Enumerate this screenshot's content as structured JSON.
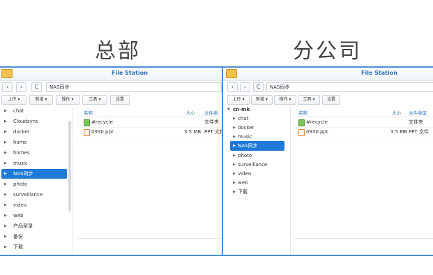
{
  "captions": {
    "hq": "总部",
    "branch": "分公司"
  },
  "hq": {
    "title": "File Station",
    "back_icon": "chevron-left-icon",
    "forward_icon": "chevron-right-icon",
    "refresh_icon": "refresh-icon",
    "back_glyph": "‹",
    "forward_glyph": "›",
    "refresh_glyph": "C",
    "path": "NAS同步",
    "toolbar": {
      "upload": "上传 ▾",
      "new": "新增 ▾",
      "action": "操作 ▾",
      "tools": "工具 ▾",
      "settings": "设置"
    },
    "sidebar": [
      {
        "label": "chat",
        "selected": false
      },
      {
        "label": "Cloudsync",
        "selected": false
      },
      {
        "label": "docker",
        "selected": false
      },
      {
        "label": "home",
        "selected": false
      },
      {
        "label": "homes",
        "selected": false
      },
      {
        "label": "music",
        "selected": false
      },
      {
        "label": "NAS同步",
        "selected": true
      },
      {
        "label": "photo",
        "selected": false
      },
      {
        "label": "surveillance",
        "selected": false
      },
      {
        "label": "video",
        "selected": false
      },
      {
        "label": "web",
        "selected": false
      },
      {
        "label": "产品型录",
        "selected": false
      },
      {
        "label": "备份",
        "selected": false
      },
      {
        "label": "下载",
        "selected": false
      }
    ],
    "columns": {
      "name": "名称",
      "size": "大小",
      "type": "文件类"
    },
    "files": [
      {
        "name": "#recycle",
        "size": "",
        "type": "文件夹",
        "icon": "recycle-folder-icon"
      },
      {
        "name": "0930.ppt",
        "size": "3.5 MB",
        "type": "PPT 文件",
        "icon": "ppt-file-icon"
      }
    ]
  },
  "branch": {
    "title": "File Station",
    "back_glyph": "‹",
    "forward_glyph": "›",
    "refresh_glyph": "C",
    "path": "NAS同步",
    "toolbar": {
      "upload": "上传 ▾",
      "new": "新增 ▾",
      "action": "操作 ▾",
      "tools": "工具 ▾",
      "settings": "设置"
    },
    "root": "cn-mk",
    "sidebar": [
      {
        "label": "chat",
        "selected": false
      },
      {
        "label": "docker",
        "selected": false
      },
      {
        "label": "music",
        "selected": false
      },
      {
        "label": "NAS同步",
        "selected": true
      },
      {
        "label": "photo",
        "selected": false
      },
      {
        "label": "surveillance",
        "selected": false
      },
      {
        "label": "video",
        "selected": false
      },
      {
        "label": "web",
        "selected": false
      },
      {
        "label": "下载",
        "selected": false
      }
    ],
    "columns": {
      "name": "名称",
      "size": "大小",
      "type": "文件类型"
    },
    "files": [
      {
        "name": "#recycle",
        "size": "",
        "type": "文件夹",
        "icon": "recycle-folder-icon"
      },
      {
        "name": "0930.ppt",
        "size": "3.5 MB",
        "type": "PPT 文件",
        "icon": "ppt-file-icon"
      }
    ]
  },
  "colors": {
    "accent": "#1e7ad6",
    "border": "#4a8fd4",
    "title": "#2a6ebb"
  }
}
